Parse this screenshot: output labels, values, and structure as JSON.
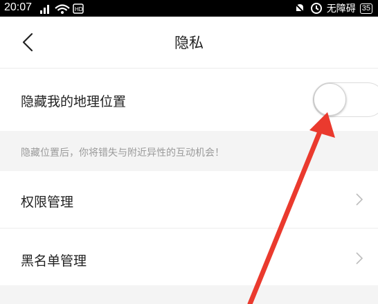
{
  "status_bar": {
    "time": "20:07",
    "accessibility_label": "无障碍",
    "battery": "35"
  },
  "header": {
    "title": "隐私"
  },
  "settings": {
    "hide_location": {
      "label": "隐藏我的地理位置",
      "enabled": false
    },
    "hint": "隐藏位置后，你将错失与附近异性的互动机会！",
    "permissions": {
      "label": "权限管理"
    },
    "blacklist": {
      "label": "黑名单管理"
    }
  },
  "colors": {
    "accent_arrow": "#ea3a2e",
    "background": "#f4f4f4"
  }
}
